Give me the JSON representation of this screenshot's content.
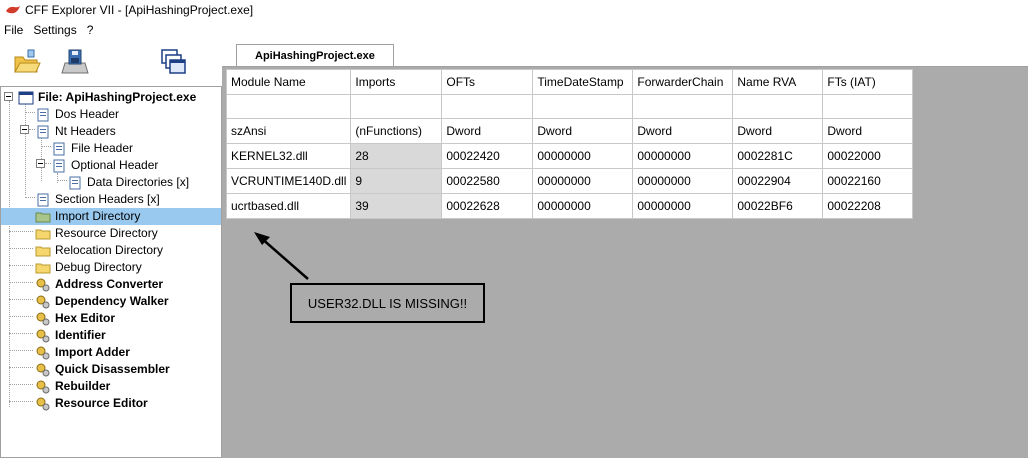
{
  "window": {
    "title": "CFF Explorer VII - [ApiHashingProject.exe]"
  },
  "menu": [
    "File",
    "Settings",
    "?"
  ],
  "toolbar": {
    "buttons": [
      "open-icon",
      "save-icon",
      "windows-icon"
    ]
  },
  "tree": {
    "root": "File: ApiHashingProject.exe",
    "items": [
      {
        "label": "Dos Header"
      },
      {
        "label": "Nt Headers"
      },
      {
        "label": "File Header"
      },
      {
        "label": "Optional Header"
      },
      {
        "label": "Data Directories [x]"
      },
      {
        "label": "Section Headers [x]"
      },
      {
        "label": "Import Directory"
      },
      {
        "label": "Resource Directory"
      },
      {
        "label": "Relocation Directory"
      },
      {
        "label": "Debug Directory"
      },
      {
        "label": "Address Converter"
      },
      {
        "label": "Dependency Walker"
      },
      {
        "label": "Hex Editor"
      },
      {
        "label": "Identifier"
      },
      {
        "label": "Import Adder"
      },
      {
        "label": "Quick Disassembler"
      },
      {
        "label": "Rebuilder"
      },
      {
        "label": "Resource Editor"
      }
    ],
    "selected": "Import Directory"
  },
  "tab": {
    "label": "ApiHashingProject.exe"
  },
  "grid": {
    "headers": [
      "Module Name",
      "Imports",
      "OFTs",
      "TimeDateStamp",
      "ForwarderChain",
      "Name RVA",
      "FTs (IAT)"
    ],
    "types": [
      "szAnsi",
      "(nFunctions)",
      "Dword",
      "Dword",
      "Dword",
      "Dword",
      "Dword"
    ],
    "rows": [
      [
        "KERNEL32.dll",
        "28",
        "00022420",
        "00000000",
        "00000000",
        "0002281C",
        "00022000"
      ],
      [
        "VCRUNTIME140D.dll",
        "9",
        "00022580",
        "00000000",
        "00000000",
        "00022904",
        "00022160"
      ],
      [
        "ucrtbased.dll",
        "39",
        "00022628",
        "00000000",
        "00000000",
        "00022BF6",
        "00022208"
      ]
    ]
  },
  "annotation": {
    "text": "USER32.DLL IS MISSING!!"
  },
  "colors": {
    "selection": "#99c9ef",
    "content_bg": "#ababab",
    "folder": "#f5d76e"
  }
}
